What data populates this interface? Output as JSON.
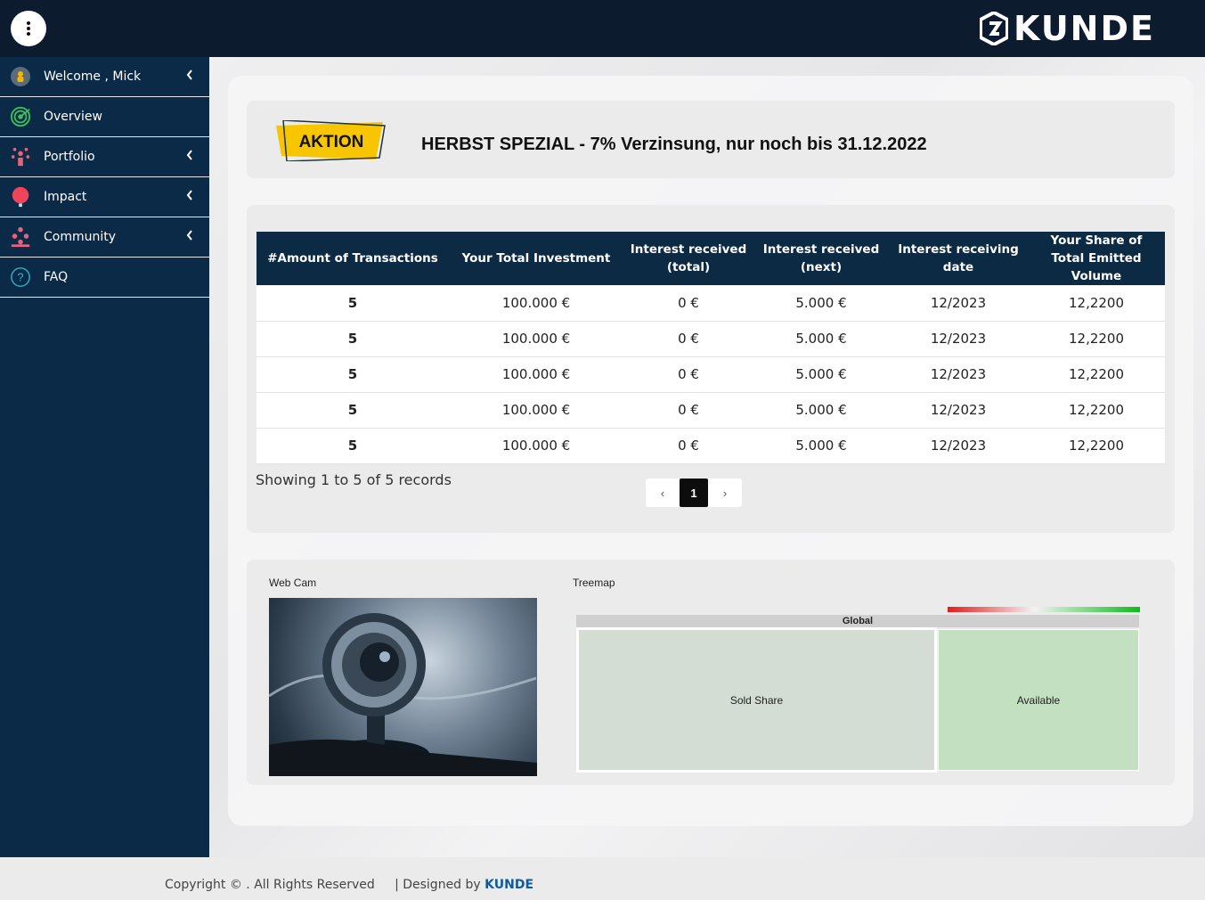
{
  "header": {
    "logo_text": "KUNDE"
  },
  "sidebar": {
    "items": [
      {
        "label": "Welcome , Mick",
        "icon": "user-icon",
        "has_chevron": true
      },
      {
        "label": "Overview",
        "icon": "target-icon",
        "has_chevron": false
      },
      {
        "label": "Portfolio",
        "icon": "portfolio-icon",
        "has_chevron": true
      },
      {
        "label": "Impact",
        "icon": "globe-icon",
        "has_chevron": true
      },
      {
        "label": "Community",
        "icon": "community-icon",
        "has_chevron": true
      },
      {
        "label": "FAQ",
        "icon": "question-icon",
        "has_chevron": false
      }
    ]
  },
  "promo": {
    "badge": "AKTION",
    "title": "HERBST SPEZIAL - 7% Verzinsung, nur noch bis 31.12.2022"
  },
  "table": {
    "columns": [
      "#Amount of Transactions",
      "Your Total Investment",
      "Interest received (total)",
      "Interest received (next)",
      "Interest receiving date",
      "Your Share of Total Emitted Volume"
    ],
    "rows": [
      [
        "5",
        "100.000 €",
        "0 €",
        "5.000 €",
        "12/2023",
        "12,2200"
      ],
      [
        "5",
        "100.000 €",
        "0 €",
        "5.000 €",
        "12/2023",
        "12,2200"
      ],
      [
        "5",
        "100.000 €",
        "0 €",
        "5.000 €",
        "12/2023",
        "12,2200"
      ],
      [
        "5",
        "100.000 €",
        "0 €",
        "5.000 €",
        "12/2023",
        "12,2200"
      ],
      [
        "5",
        "100.000 €",
        "0 €",
        "5.000 €",
        "12/2023",
        "12,2200"
      ]
    ],
    "showing": "Showing 1 to 5 of 5 records",
    "pagination": {
      "prev": "‹",
      "current": "1",
      "next": "›"
    }
  },
  "widgets": {
    "webcam_label": "Web Cam",
    "treemap_label": "Treemap",
    "treemap": {
      "root": "Global",
      "nodes": [
        "Sold Share",
        "Available"
      ]
    }
  },
  "footer": {
    "copyright": "Copyright © . All Rights Reserved",
    "designed_by": "| Designed by",
    "brand": "KUNDE"
  },
  "colors": {
    "sidebar": "#0b2a47",
    "topbar": "#0d1b2e",
    "table_header": "#0d2a45",
    "badge": "#f7c600"
  }
}
